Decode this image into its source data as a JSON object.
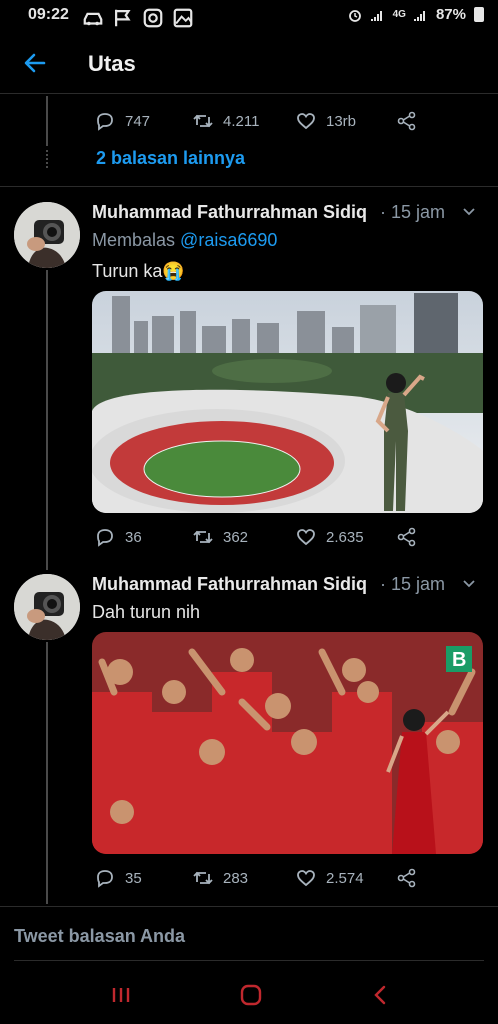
{
  "status_bar": {
    "time": "09:22",
    "left_icons": [
      "car-icon",
      "flag-icon",
      "instagram-icon",
      "image-icon"
    ],
    "network": "4G",
    "battery": "87%"
  },
  "header": {
    "back_icon": "arrow-left-icon",
    "title": "Utas"
  },
  "parent_tweet": {
    "replies": "747",
    "retweets": "4.211",
    "likes": "13rb"
  },
  "more_replies_link": "2 balasan lainnya",
  "tweets": [
    {
      "author": "Muhammad Fathurrahman Sidiq",
      "time": "· 15 jam",
      "reply_prefix": "Membalas",
      "reply_handle": "@raisa6690",
      "text": "Turun ka😭",
      "media": "stadium-photo",
      "replies": "36",
      "retweets": "362",
      "likes": "2.635"
    },
    {
      "author": "Muhammad Fathurrahman Sidiq",
      "time": "· 15 jam",
      "text": "Dah turun nih",
      "media": "crowd-photo",
      "replies": "35",
      "retweets": "283",
      "likes": "2.574"
    }
  ],
  "compose_placeholder": "Tweet balasan Anda",
  "colors": {
    "accent": "#1d9bf0",
    "background": "#000000",
    "muted": "#8b98a5"
  }
}
